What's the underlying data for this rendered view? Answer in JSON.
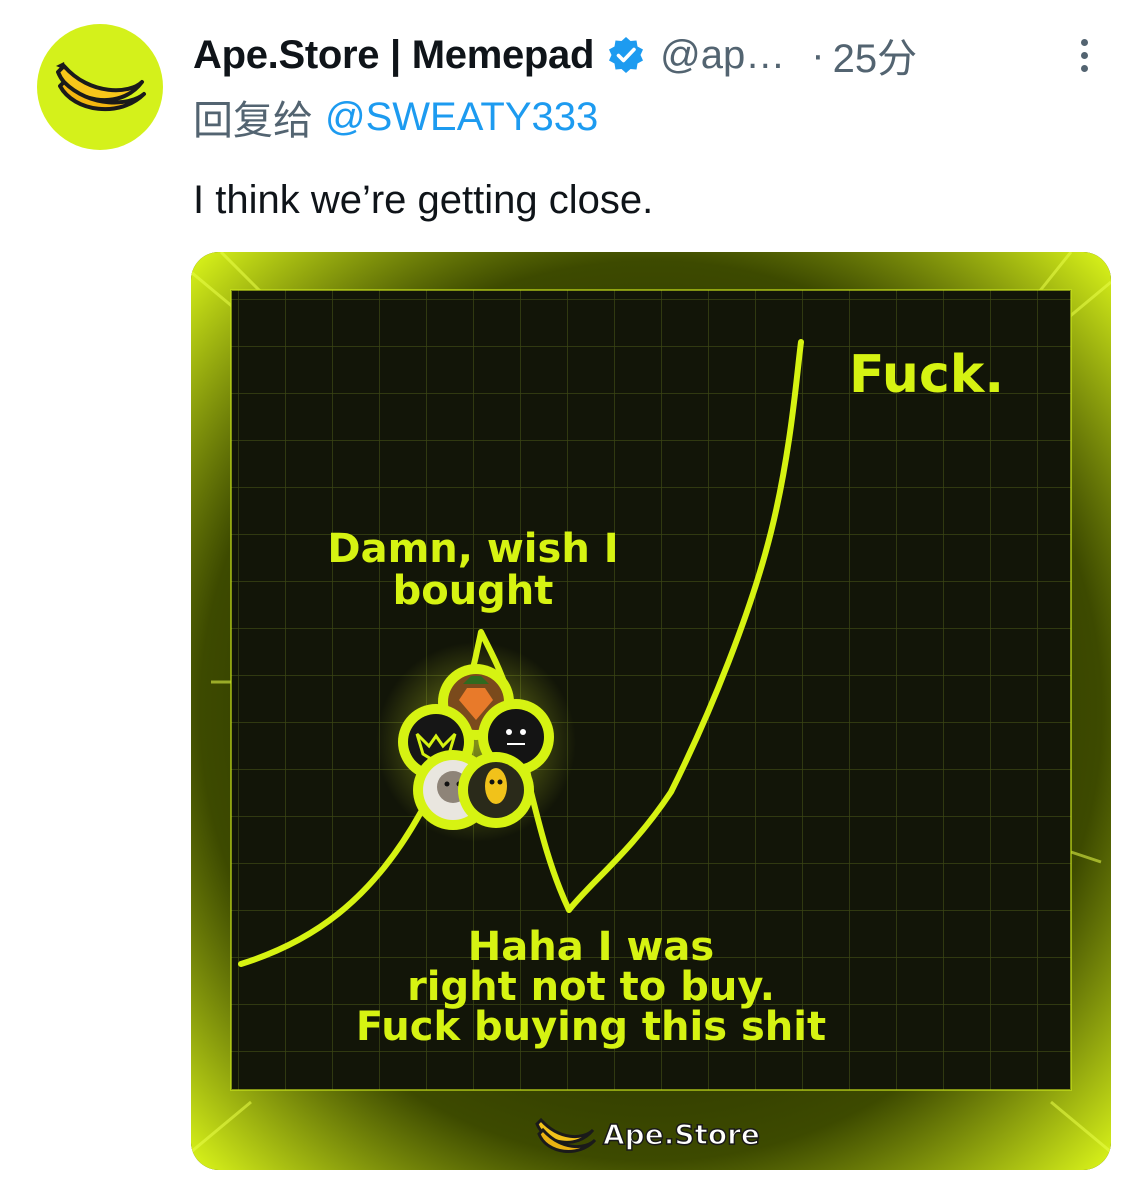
{
  "tweet": {
    "display_name": "Ape.Store | Memepad",
    "verified_icon": "verified-badge-icon",
    "handle": "@ap…",
    "separator": "·",
    "time": "25分",
    "more_icon": "more-vertical-icon",
    "reply_prefix": "回复给",
    "reply_handle": "@SWEATY333",
    "text": "I think we’re getting close."
  },
  "media": {
    "annotation_top": "Fuck.",
    "annotation_mid_line1": "Damn, wish I",
    "annotation_mid_line2": "bought",
    "annotation_bottom_line1": "Haha I was",
    "annotation_bottom_line2": "right not to buy.",
    "annotation_bottom_line3": "Fuck buying this shit",
    "brand_logo_text": "Ape.Store"
  },
  "colors": {
    "accent_lime": "#d6f312",
    "link_blue": "#1d9bf0",
    "muted_gray": "#536471"
  }
}
